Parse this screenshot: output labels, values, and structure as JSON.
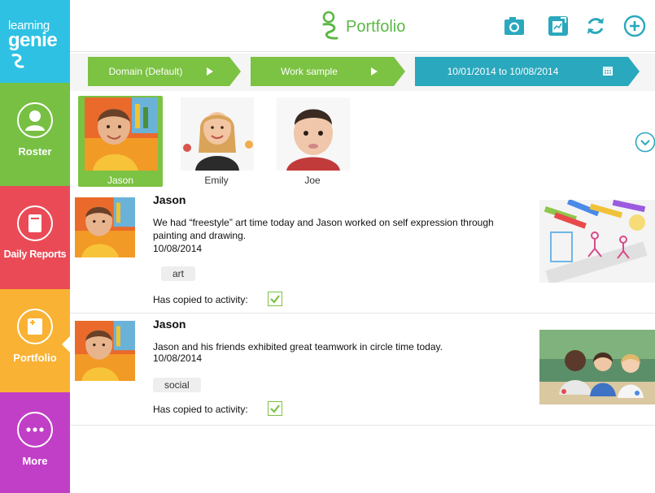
{
  "app": {
    "logo_line1": "learning",
    "logo_line2": "genie",
    "title": "Portfolio"
  },
  "sidebar": {
    "items": [
      {
        "label": "Roster",
        "icon": "person-icon",
        "color": "#77c043"
      },
      {
        "label": "Daily Reports",
        "icon": "report-icon",
        "color": "#ea4a56"
      },
      {
        "label": "Portfolio",
        "icon": "portfolio-icon",
        "color": "#f9b233",
        "active": true
      },
      {
        "label": "More",
        "icon": "more-icon",
        "color": "#c13fc6"
      }
    ]
  },
  "header": {
    "icons": [
      "camera-icon",
      "report-upload-icon",
      "sync-icon",
      "add-icon"
    ],
    "accent": "#2aa8bd"
  },
  "filters": {
    "domain": "Domain (Default)",
    "sample": "Work sample",
    "date_range": "10/01/2014 to 10/08/2014"
  },
  "students": [
    {
      "name": "Jason",
      "selected": true
    },
    {
      "name": "Emily",
      "selected": false
    },
    {
      "name": "Joe",
      "selected": false
    }
  ],
  "posts": [
    {
      "name": "Jason",
      "text": "We had “freestyle” art time today and Jason worked on self expression through painting and drawing.",
      "date": "10/08/2014",
      "tag": "art",
      "copied_label": "Has copied to activity:",
      "copied": true
    },
    {
      "name": "Jason",
      "text": "Jason and his friends exhibited great teamwork in circle time today.",
      "date": "10/08/2014",
      "tag": "social",
      "copied_label": "Has copied to activity:",
      "copied": true
    }
  ]
}
